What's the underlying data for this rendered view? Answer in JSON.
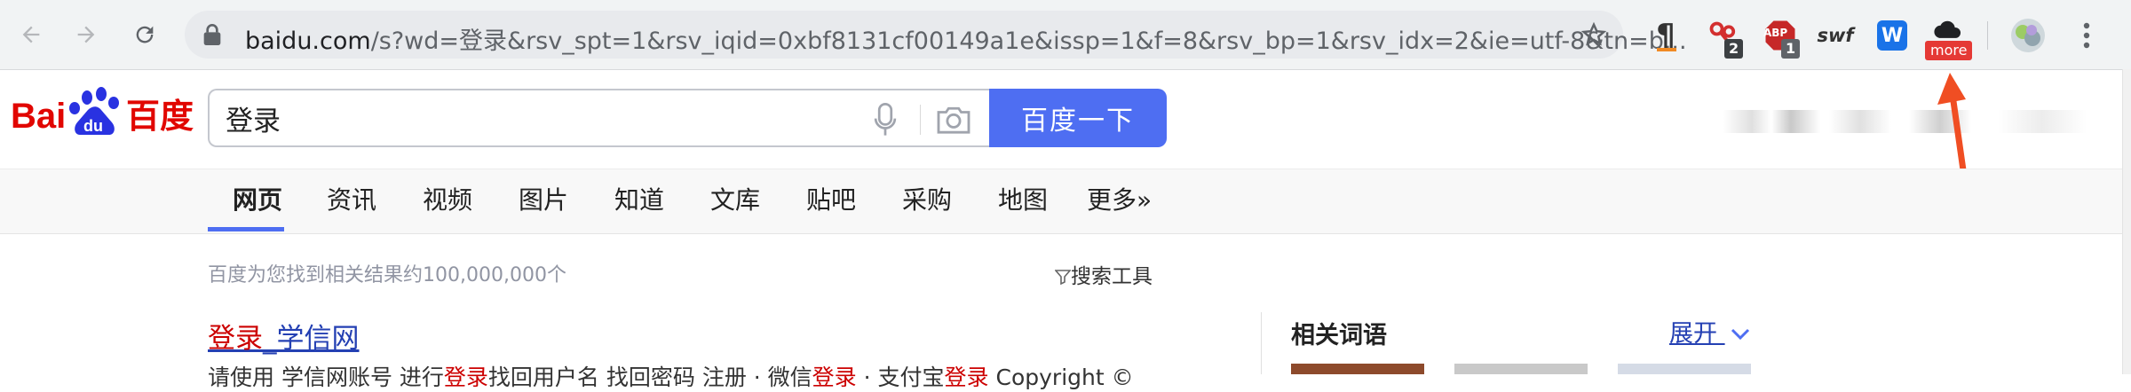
{
  "browser": {
    "url_host": "baidu.com",
    "url_rest": "/s?wd=登录&rsv_spt=1&rsv_iqid=0xbf8131cf00149a1e&issp=1&f=8&rsv_bp=1&rsv_idx=2&ie=utf-8&tn=b...",
    "extensions": {
      "paragraph_label": "¶",
      "red_badge": "2",
      "abp_label": "ABP",
      "abp_badge": "1",
      "swf_label": "swf",
      "w_label": "W",
      "more_badge": "more"
    }
  },
  "search": {
    "query": "登录",
    "button_label": "百度一下"
  },
  "tabs": [
    "网页",
    "资讯",
    "视频",
    "图片",
    "知道",
    "文库",
    "贴吧",
    "采购",
    "地图",
    "更多»"
  ],
  "results": {
    "stats": "百度为您找到相关结果约100,000,000个",
    "tools_label": "搜索工具",
    "first": {
      "title_hl": "登录",
      "title_rest": "_学信网",
      "snippet_1": "请使用 学信网账号 进行",
      "snippet_hl1": "登录",
      "snippet_2": "找回用户名 找回密码 注册 · 微信",
      "snippet_hl2": "登录",
      "snippet_3": " · 支付宝",
      "snippet_hl3": "登录",
      "snippet_4": " Copyright ©"
    }
  },
  "sidebar": {
    "related_title": "相关词语",
    "expand_label": "展开"
  },
  "colors": {
    "accent": "#4e6ef2",
    "highlight": "#cc0000",
    "annotation_arrow": "#f04e23"
  }
}
